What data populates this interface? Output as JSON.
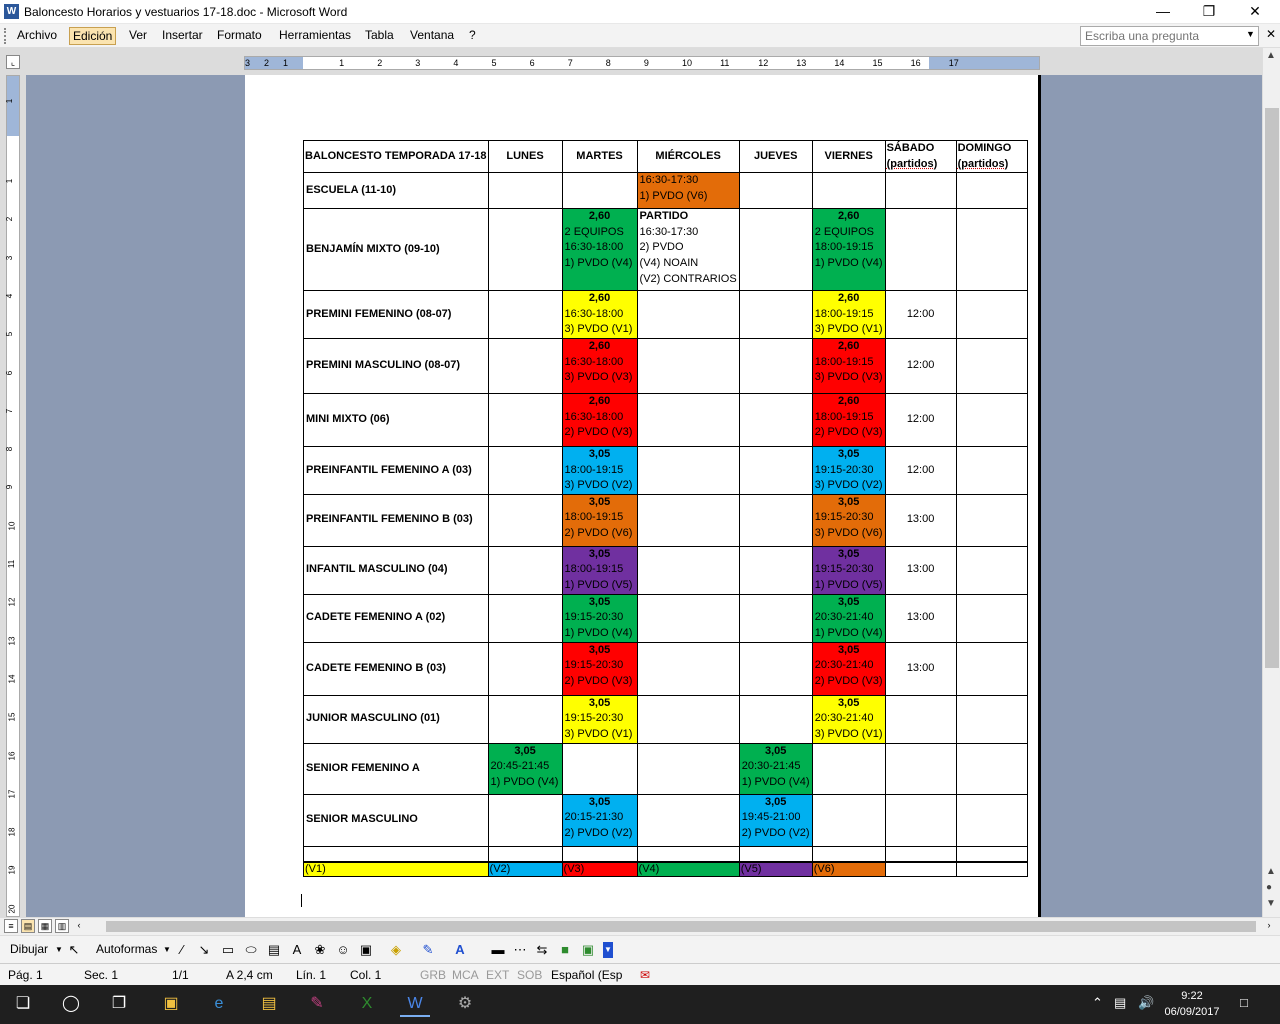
{
  "window": {
    "title": "Baloncesto Horarios y vestuarios 17-18.doc - Microsoft Word"
  },
  "menu": {
    "items": [
      "Archivo",
      "Edición",
      "Ver",
      "Insertar",
      "Formato",
      "Herramientas",
      "Tabla",
      "Ventana",
      "?"
    ],
    "active": "Edición",
    "ask_placeholder": "Escriba una pregunta"
  },
  "ruler": {
    "h_numbers": [
      "3",
      "2",
      "1",
      "1",
      "2",
      "3",
      "4",
      "5",
      "6",
      "7",
      "8",
      "9",
      "10",
      "11",
      "12",
      "13",
      "14",
      "15",
      "16",
      "17"
    ],
    "v_numbers": [
      "1",
      "1",
      "2",
      "3",
      "4",
      "5",
      "6",
      "7",
      "8",
      "9",
      "10",
      "11",
      "12",
      "13",
      "14",
      "15",
      "16",
      "17",
      "18",
      "19",
      "20"
    ]
  },
  "colors": {
    "V1": "#ffff00",
    "V2": "#00b0f0",
    "V3": "#ff0000",
    "V4": "#00b050",
    "V5": "#7030a0",
    "V6": "#e36c09"
  },
  "table": {
    "headers": [
      "BALONCESTO TEMPORADA 17-18",
      "LUNES",
      "MARTES",
      "MIÉRCOLES",
      "JUEVES",
      "VIERNES",
      [
        "SÁBADO",
        "(partidos)"
      ],
      [
        "DOMINGO",
        "(partidos)"
      ]
    ],
    "rows": [
      {
        "name": "ESCUELA (11-10)",
        "cells": [
          null,
          null,
          {
            "lines": [
              "16:30-17:30",
              "1) PVDO (V6)"
            ],
            "v": "V6"
          },
          null,
          null,
          null,
          null
        ]
      },
      {
        "name": "BENJAMÍN MIXTO (09-10)",
        "cells": [
          null,
          {
            "price": "2,60",
            "lines": [
              "2 EQUIPOS",
              "16:30-18:00",
              "1) PVDO (V4)"
            ],
            "v": "V4"
          },
          {
            "title": "PARTIDO",
            "lines": [
              "16:30-17:30",
              "2) PVDO",
              "(V4) NOAIN",
              "(V2) CONTRARIOS"
            ]
          },
          null,
          {
            "price": "2,60",
            "lines": [
              "2 EQUIPOS",
              "18:00-19:15",
              "1) PVDO (V4)"
            ],
            "v": "V4"
          },
          null,
          null
        ]
      },
      {
        "name": "PREMINI FEMENINO (08-07)",
        "cells": [
          null,
          {
            "price": "2,60",
            "lines": [
              "16:30-18:00",
              "3) PVDO (V1)"
            ],
            "v": "V1"
          },
          null,
          null,
          {
            "price": "2,60",
            "lines": [
              "18:00-19:15",
              "3) PVDO (V1)"
            ],
            "v": "V1"
          },
          "12:00",
          null
        ]
      },
      {
        "name": "PREMINI MASCULINO (08-07)",
        "cells": [
          null,
          {
            "price": "2,60",
            "lines": [
              "16:30-18:00",
              "3) PVDO (V3)"
            ],
            "v": "V3"
          },
          null,
          null,
          {
            "price": "2,60",
            "lines": [
              "18:00-19:15",
              "3) PVDO (V3)"
            ],
            "v": "V3"
          },
          "12:00",
          null
        ]
      },
      {
        "name": "MINI MIXTO (06)",
        "cells": [
          null,
          {
            "price": "2,60",
            "lines": [
              "16:30-18:00",
              "2) PVDO (V3)"
            ],
            "v": "V3"
          },
          null,
          null,
          {
            "price": "2,60",
            "lines": [
              "18:00-19:15",
              "2) PVDO (V3)"
            ],
            "v": "V3"
          },
          "12:00",
          null
        ]
      },
      {
        "name": "PREINFANTIL FEMENINO A (03)",
        "cells": [
          null,
          {
            "price": "3,05",
            "lines": [
              "18:00-19:15",
              "3) PVDO (V2)"
            ],
            "v": "V2"
          },
          null,
          null,
          {
            "price": "3,05",
            "lines": [
              "19:15-20:30",
              "3) PVDO (V2)"
            ],
            "v": "V2"
          },
          "12:00",
          null
        ]
      },
      {
        "name": "PREINFANTIL FEMENINO B (03)",
        "cells": [
          null,
          {
            "price": "3,05",
            "lines": [
              "18:00-19:15",
              "2) PVDO (V6)"
            ],
            "v": "V6"
          },
          null,
          null,
          {
            "price": "3,05",
            "lines": [
              "19:15-20:30",
              "3) PVDO (V6)"
            ],
            "v": "V6"
          },
          "13:00",
          null
        ]
      },
      {
        "name": "INFANTIL MASCULINO (04)",
        "cells": [
          null,
          {
            "price": "3,05",
            "lines": [
              "18:00-19:15",
              "1) PVDO (V5)"
            ],
            "v": "V5"
          },
          null,
          null,
          {
            "price": "3,05",
            "lines": [
              "19:15-20:30",
              "1) PVDO (V5)"
            ],
            "v": "V5"
          },
          "13:00",
          null
        ]
      },
      {
        "name": "CADETE FEMENINO A (02)",
        "cells": [
          null,
          {
            "price": "3,05",
            "lines": [
              "19:15-20:30",
              "1) PVDO (V4)"
            ],
            "v": "V4"
          },
          null,
          null,
          {
            "price": "3,05",
            "lines": [
              "20:30-21:40",
              "1) PVDO (V4)"
            ],
            "v": "V4"
          },
          "13:00",
          null
        ]
      },
      {
        "name": "CADETE FEMENINO B (03)",
        "cells": [
          null,
          {
            "price": "3,05",
            "lines": [
              "19:15-20:30",
              "2) PVDO (V3)"
            ],
            "v": "V3"
          },
          null,
          null,
          {
            "price": "3,05",
            "lines": [
              "20:30-21:40",
              "2) PVDO (V3)"
            ],
            "v": "V3"
          },
          "13:00",
          null
        ]
      },
      {
        "name": "JUNIOR MASCULINO (01)",
        "cells": [
          null,
          {
            "price": "3,05",
            "lines": [
              "19:15-20:30",
              "3) PVDO (V1)"
            ],
            "v": "V1"
          },
          null,
          null,
          {
            "price": "3,05",
            "lines": [
              "20:30-21:40",
              "3) PVDO (V1)"
            ],
            "v": "V1"
          },
          null,
          null
        ]
      },
      {
        "name": "SENIOR FEMENINO A",
        "cells": [
          {
            "price": "3,05",
            "lines": [
              "20:45-21:45",
              "1) PVDO (V4)"
            ],
            "v": "V4"
          },
          null,
          null,
          {
            "price": "3,05",
            "lines": [
              "20:30-21:45",
              "1) PVDO (V4)"
            ],
            "v": "V4"
          },
          null,
          null,
          null
        ]
      },
      {
        "name": "SENIOR MASCULINO",
        "cells": [
          null,
          {
            "price": "3,05",
            "lines": [
              "20:15-21:30",
              "2) PVDO (V2)"
            ],
            "v": "V2"
          },
          null,
          {
            "price": "3,05",
            "lines": [
              "19:45-21:00",
              "2) PVDO (V2)"
            ],
            "v": "V2"
          },
          null,
          null,
          null
        ]
      }
    ],
    "legend": [
      "(V1)",
      "(V2)",
      "(V3)",
      "(V4)",
      "(V5)",
      "(V6)"
    ]
  },
  "drawbar": {
    "dibujar": "Dibujar",
    "autoformas": "Autoformas"
  },
  "status": {
    "pag": "Pág. 1",
    "sec": "Sec. 1",
    "frac": "1/1",
    "pos": "A 2,4 cm",
    "lin": "Lín. 1",
    "col": "Col. 1",
    "flags": [
      "GRB",
      "MCA",
      "EXT",
      "SOB"
    ],
    "lang": "Español (Esp"
  },
  "taskbar": {
    "time": "9:22",
    "date": "06/09/2017"
  }
}
